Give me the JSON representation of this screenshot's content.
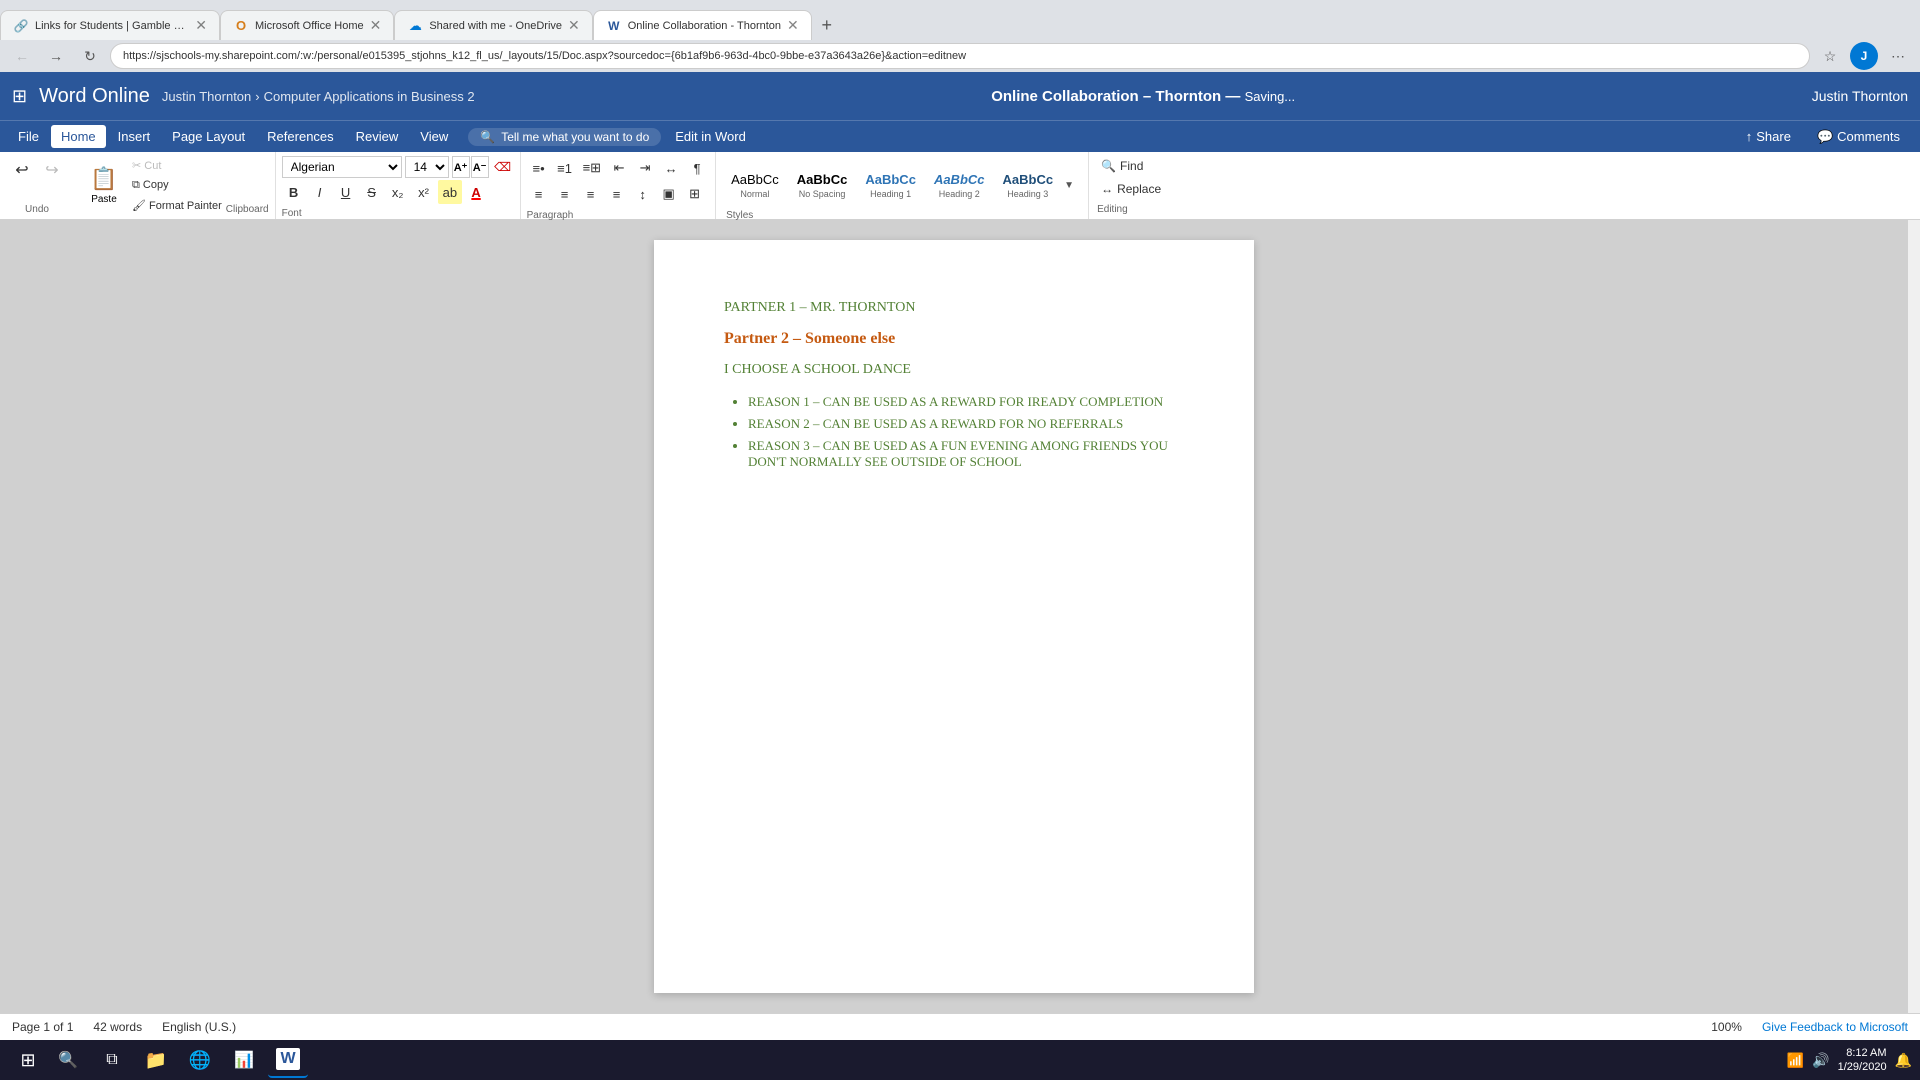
{
  "browser": {
    "tabs": [
      {
        "id": "tab1",
        "label": "Links for Students | Gamble Roo...",
        "favicon": "🔗",
        "active": false,
        "closable": true
      },
      {
        "id": "tab2",
        "label": "Microsoft Office Home",
        "favicon": "⬜",
        "active": false,
        "closable": true
      },
      {
        "id": "tab3",
        "label": "Shared with me - OneDrive",
        "favicon": "☁",
        "active": false,
        "closable": true
      },
      {
        "id": "tab4",
        "label": "Online Collaboration - Thornton",
        "favicon": "W",
        "active": true,
        "closable": true
      }
    ],
    "address": "https://sjschools-my.sharepoint.com/:w:/personal/e015395_stjohns_k12_fl_us/_layouts/15/Doc.aspx?sourcedoc={6b1af9b6-963d-4bc0-9bbe-e37a3643a26e}&action=editnew",
    "new_tab": "+"
  },
  "appbar": {
    "grid_icon": "⊞",
    "title": "Word Online",
    "breadcrumb_user": "Justin Thornton",
    "breadcrumb_sep": "›",
    "breadcrumb_course": "Computer Applications in Business 2",
    "doc_title": "Online Collaboration – Thornton",
    "dash": "—",
    "saving": "Saving...",
    "user_name": "Justin Thornton"
  },
  "menubar": {
    "items": [
      "File",
      "Home",
      "Insert",
      "Page Layout",
      "References",
      "Review",
      "View"
    ],
    "active": "Home",
    "tell_me": "Tell me what you want to do",
    "edit_in_word": "Edit in Word",
    "share": "Share",
    "comments": "Comments"
  },
  "ribbon": {
    "undo_label": "Undo",
    "redo_label": "Redo",
    "paste_label": "Paste",
    "cut_label": "✂ Cut",
    "copy_label": "Copy",
    "format_painter_label": "Format Painter",
    "clipboard_label": "Clipboard",
    "font_name": "Algerian",
    "font_size": "14",
    "font_label": "Font",
    "bold": "B",
    "italic": "I",
    "underline": "U",
    "strikethrough": "S",
    "subscript": "x₂",
    "superscript": "x²",
    "highlight": "ab",
    "font_color": "A",
    "paragraph_label": "Paragraph",
    "editing_label": "Editing",
    "find_label": "Find",
    "replace_label": "Replace",
    "styles": [
      {
        "label": "Normal",
        "preview": "AaBbCc"
      },
      {
        "label": "No Spacing",
        "preview": "AaBbCc"
      },
      {
        "label": "Heading 1",
        "preview": "AaBbCc"
      },
      {
        "label": "Heading 2",
        "preview": "AaBbCc"
      },
      {
        "label": "Heading 3",
        "preview": "AaBbCc"
      }
    ],
    "styles_label": "Styles"
  },
  "document": {
    "partner1": "PARTNER 1 – MR. THORNTON",
    "partner2_start": "Partner 2 –",
    "partner2_end": "Someone else",
    "heading": "I CHOOSE A SCHOOL DANCE",
    "bullets": [
      "REASON 1 – CAN BE USED AS A REWARD FOR IREADY COMPLETION",
      "REASON 2 – CAN BE USED AS A REWARD FOR NO REFERRALS",
      "REASON 3 – CAN BE USED AS A FUN EVENING AMONG FRIENDS YOU DON'T NORMALLY SEE OUTSIDE OF SCHOOL"
    ]
  },
  "statusbar": {
    "page": "Page 1 of 1",
    "words": "42 words",
    "language": "English (U.S.)",
    "zoom": "100%",
    "feedback": "Give Feedback to Microsoft"
  },
  "taskbar": {
    "time": "8:12 AM",
    "date": "1/29/2020",
    "items": [
      {
        "label": "Windows",
        "icon": "⊞"
      },
      {
        "label": "Search",
        "icon": "🔍"
      },
      {
        "label": "Task View",
        "icon": "⧉"
      },
      {
        "label": "File Explorer",
        "icon": "📁"
      },
      {
        "label": "Edge",
        "icon": "🌐"
      },
      {
        "label": "PowerPoint",
        "icon": "📊"
      },
      {
        "label": "Word Online",
        "icon": "W"
      }
    ]
  }
}
